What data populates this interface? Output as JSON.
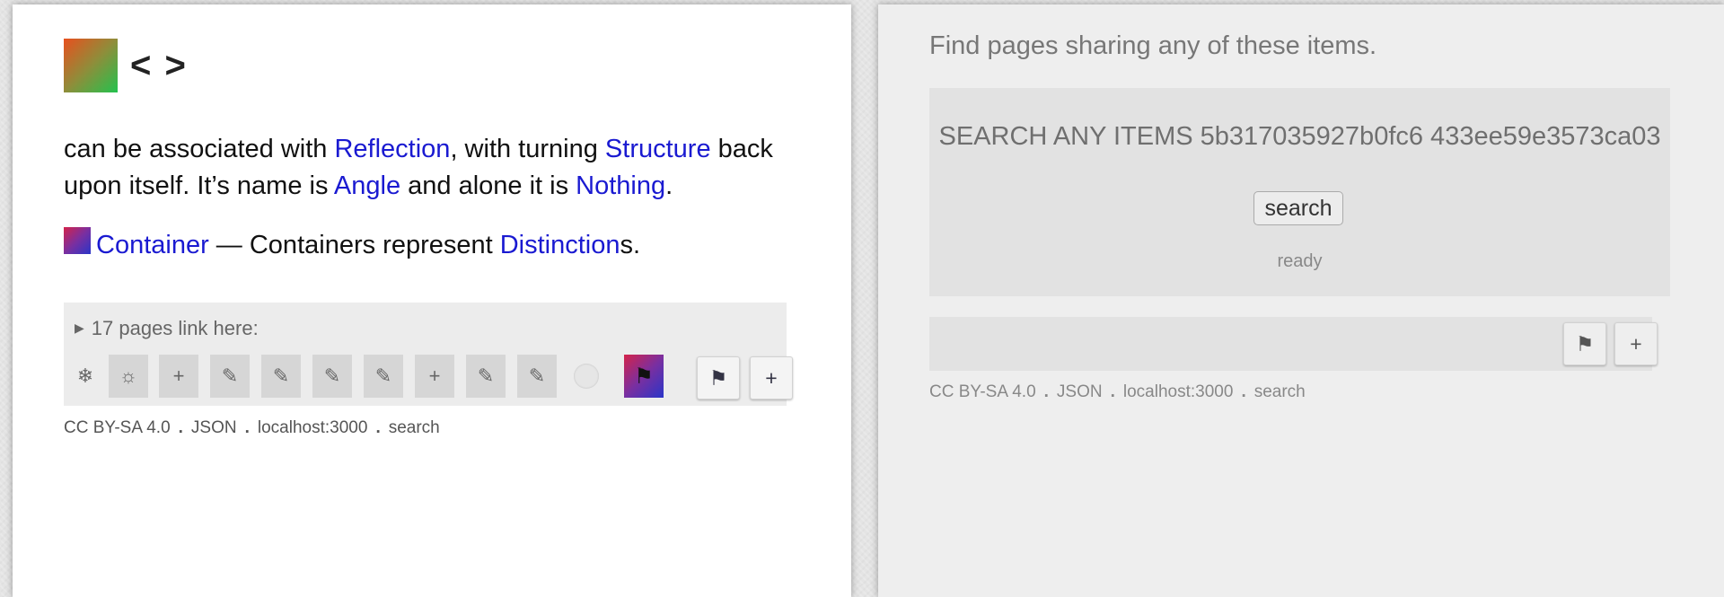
{
  "left": {
    "title": "< >",
    "para1": {
      "t1": "can be associated with ",
      "l1": "Reflection",
      "t2": ", with turning ",
      "l2": "Structure",
      "t3": " back upon itself. It’s name is ",
      "l3": "Angle",
      "t4": " and alone it is ",
      "l4": "Nothing",
      "t5": "."
    },
    "para2": {
      "l1": "Container",
      "t1": " — Containers represent ",
      "l2": "Distinction",
      "t2": "s."
    },
    "references": {
      "summary": "17 pages link here:",
      "summary_marker": "▶"
    },
    "journal": [
      {
        "icon": "snowflake-icon",
        "glyph": "❄"
      },
      {
        "icon": "sun-icon",
        "glyph": "☼"
      },
      {
        "icon": "add-icon",
        "glyph": "+"
      },
      {
        "icon": "pencil-icon",
        "glyph": "✎"
      },
      {
        "icon": "pencil-icon",
        "glyph": "✎"
      },
      {
        "icon": "pencil-icon",
        "glyph": "✎"
      },
      {
        "icon": "pencil-icon",
        "glyph": "✎"
      },
      {
        "icon": "add-icon",
        "glyph": "+"
      },
      {
        "icon": "pencil-icon",
        "glyph": "✎"
      },
      {
        "icon": "pencil-icon",
        "glyph": "✎"
      },
      {
        "icon": "circle-icon",
        "glyph": ""
      },
      {
        "icon": "flag-icon",
        "glyph": "⚑"
      }
    ],
    "buttons": {
      "flag": "⚑",
      "add": "+"
    },
    "footer": {
      "license": "CC BY-SA 4.0",
      "sep": ".",
      "json": "JSON",
      "host": "localhost:3000",
      "search": "search"
    }
  },
  "right": {
    "prompt": "Find pages sharing any of these items.",
    "search_title": "SEARCH ANY ITEMS 5b317035927b0fc6 433ee59e3573ca03",
    "search_button": "search",
    "status": "ready",
    "buttons": {
      "flag": "⚑",
      "add": "+"
    },
    "footer": {
      "license": "CC BY-SA 4.0",
      "sep": ".",
      "json": "JSON",
      "host": "localhost:3000",
      "search": "search"
    }
  },
  "colors": {
    "link": "#1a1ad1",
    "favicon_gradient": [
      "#e8501e",
      "#23c24e"
    ],
    "container_gradient": [
      "#d4234a",
      "#2a35c8"
    ]
  }
}
